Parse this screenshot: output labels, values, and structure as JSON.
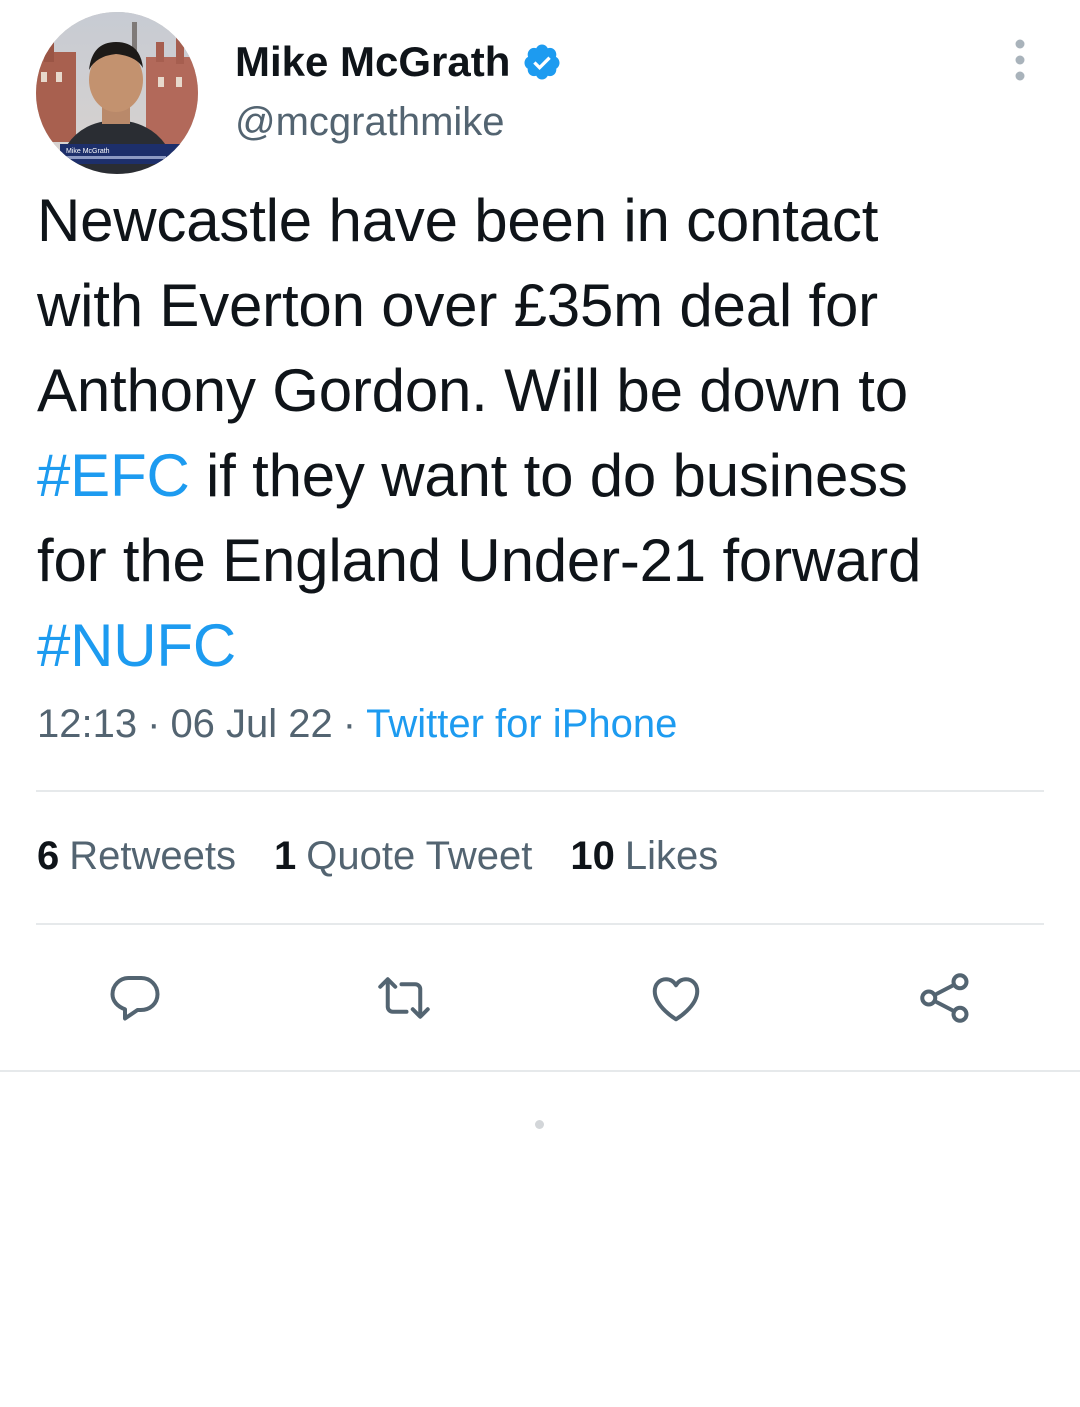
{
  "tweet": {
    "author": {
      "display_name": "Mike McGrath",
      "handle": "@mcgrathmike",
      "verified": true,
      "avatar_caption": "Mike McGrath"
    },
    "text_lines": [
      [
        {
          "text": "Newcastle have been in contact",
          "type": "text"
        }
      ],
      [
        {
          "text": "with Everton over £35m deal for",
          "type": "text"
        }
      ],
      [
        {
          "text": "Anthony Gordon. Will be down to",
          "type": "text"
        }
      ],
      [
        {
          "text": "#EFC",
          "type": "hashtag"
        },
        {
          "text": " if they want to do business",
          "type": "text"
        }
      ],
      [
        {
          "text": "for the England Under-21 forward",
          "type": "text"
        }
      ],
      [
        {
          "text": "#NUFC",
          "type": "hashtag"
        }
      ]
    ],
    "meta": {
      "time": "12:13",
      "separator": "·",
      "date": "06 Jul 22",
      "source": "Twitter for iPhone"
    },
    "stats": [
      {
        "count": "6",
        "label": "Retweets"
      },
      {
        "count": "1",
        "label": "Quote Tweet"
      },
      {
        "count": "10",
        "label": "Likes"
      }
    ],
    "actions": [
      {
        "name": "reply",
        "icon": "reply-icon"
      },
      {
        "name": "retweet",
        "icon": "retweet-icon"
      },
      {
        "name": "like",
        "icon": "heart-icon"
      },
      {
        "name": "share",
        "icon": "share-icon"
      }
    ]
  },
  "colors": {
    "link": "#1d9bf0",
    "text": "#0f1419",
    "secondary": "#536471",
    "divider": "#e6e9eb",
    "icon": "#536471"
  }
}
